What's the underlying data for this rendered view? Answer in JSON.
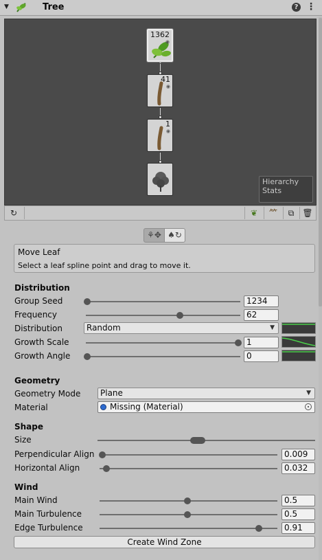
{
  "header": {
    "title": "Tree",
    "help": "?",
    "menu": "⋮"
  },
  "hierarchy": {
    "nodes": [
      {
        "type": "leaf",
        "count": "1362",
        "selected": true
      },
      {
        "type": "branch",
        "count": "41"
      },
      {
        "type": "branch",
        "count": "1"
      },
      {
        "type": "root",
        "count": ""
      }
    ],
    "stats_label": "Hierarchy Stats"
  },
  "tool_info": {
    "title": "Move Leaf",
    "description": "Select a leaf spline point and drag to move it."
  },
  "distribution": {
    "heading": "Distribution",
    "group_seed": {
      "label": "Group Seed",
      "value": "1234",
      "slider": 0.0
    },
    "frequency": {
      "label": "Frequency",
      "value": "62",
      "slider": 0.6
    },
    "distribution": {
      "label": "Distribution",
      "value": "Random"
    },
    "growth_scale": {
      "label": "Growth Scale",
      "value": "1",
      "slider": 1.0
    },
    "growth_angle": {
      "label": "Growth Angle",
      "value": "0",
      "slider": 0.0
    }
  },
  "geometry": {
    "heading": "Geometry",
    "mode": {
      "label": "Geometry Mode",
      "value": "Plane"
    },
    "material": {
      "label": "Material",
      "value": "Missing (Material)"
    }
  },
  "shape": {
    "heading": "Shape",
    "size": {
      "label": "Size"
    },
    "perpendicular_align": {
      "label": "Perpendicular Align",
      "value": "0.009",
      "slider": 0.009
    },
    "horizontal_align": {
      "label": "Horizontal Align",
      "value": "0.032",
      "slider": 0.032
    }
  },
  "wind": {
    "heading": "Wind",
    "main_wind": {
      "label": "Main Wind",
      "value": "0.5",
      "slider": 0.5
    },
    "main_turbulence": {
      "label": "Main Turbulence",
      "value": "0.5",
      "slider": 0.5
    },
    "edge_turbulence": {
      "label": "Edge Turbulence",
      "value": "0.91",
      "slider": 0.91
    },
    "create_button": "Create Wind Zone"
  }
}
